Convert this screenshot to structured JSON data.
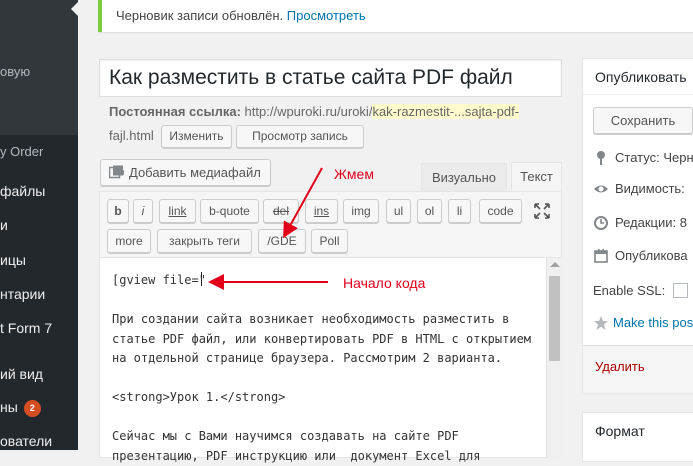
{
  "sidebar": {
    "items": [
      {
        "label": "",
        "style": "red"
      },
      {
        "label": "овую",
        "style": "sub"
      },
      {
        "label": "y Order",
        "style": "sub"
      },
      {
        "label": "файлы",
        "style": "main"
      },
      {
        "label": "и",
        "style": "main"
      },
      {
        "label": "ицы",
        "style": "main"
      },
      {
        "label": "нтарии",
        "style": "main"
      },
      {
        "label": "t Form 7",
        "style": "main"
      },
      {
        "label": "ий вид",
        "style": "main"
      },
      {
        "label": "ны",
        "style": "main",
        "badge": "2"
      },
      {
        "label": "ователи",
        "style": "main"
      }
    ]
  },
  "notice": {
    "text": "Черновик записи обновлён.",
    "link": "Просмотреть"
  },
  "post": {
    "title": "Как разместить в статье сайта PDF файл",
    "permalink_label": "Постоянная ссылка:",
    "permalink_base": "http://wpuroki.ru/uroki/",
    "permalink_slug_1": "kak-razmestit-...sajta-pdf-",
    "permalink_slug_2": "fajl",
    "permalink_ext": ".html",
    "edit_button": "Изменить",
    "view_button": "Просмотр запись"
  },
  "editor": {
    "add_media": "Добавить медиафайл",
    "tab_visual": "Визуально",
    "tab_text": "Текст",
    "quicktags_row1": [
      "b",
      "i",
      "link",
      "b-quote",
      "del",
      "ins",
      "img",
      "ul",
      "ol",
      "li",
      "code"
    ],
    "quicktags_row2": [
      "more",
      "закрыть теги",
      "/GDE",
      "Poll"
    ],
    "content": "[gview file=\"\n\nПри создании сайта возникает необходимость разместить в статье PDF файл, или конвертировать PDF в HTML с открытием на отдельной странице браузера. Рассмотрим 2 варианта.\n\n<strong>Урок 1.</strong>\n\nСейчас мы с Вами научимся создавать на сайте PDF презентацию, PDF инструкцию или  документ Excel для"
  },
  "annotations": {
    "press": "Жмем",
    "code_start": "Начало кода",
    "color": "#e3001b"
  },
  "publish": {
    "title": "Опубликовать",
    "save_button": "Сохранить",
    "status": "Статус: Черн",
    "visibility": "Видимость:",
    "revisions": "Редакции: 8",
    "published": "Опубликова",
    "ssl": "Enable SSL:",
    "sticky": "Make this pos",
    "delete": "Удалить"
  },
  "format_box": {
    "title": "Формат"
  },
  "colors": {
    "sidebar_bg": "#23282d",
    "link": "#0073aa",
    "notice_border": "#7ad03a",
    "delete": "#a00"
  }
}
